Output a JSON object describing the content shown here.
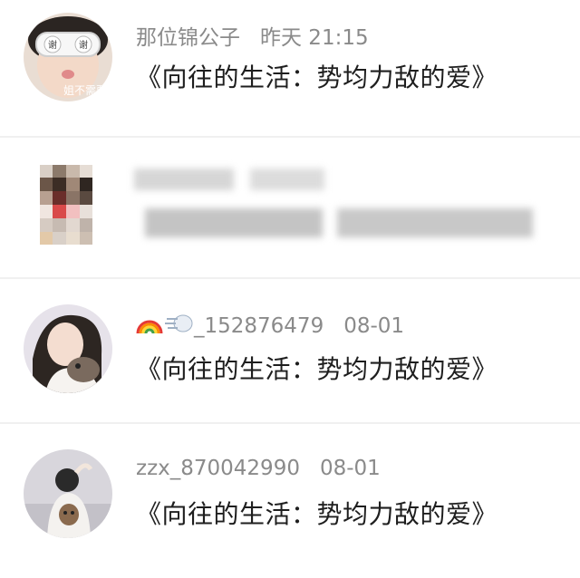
{
  "comments": [
    {
      "user": "那位锦公子",
      "time": "昨天 21:15",
      "text": "《向往的生活：势均力敌的爱》",
      "avatar_overlay_text": "姐不需要"
    },
    {
      "user": "",
      "time": "",
      "text": "",
      "blurred": true
    },
    {
      "user_emoji_1": "🌈",
      "user_emoji_2": "💨",
      "user": "_152876479",
      "time": "08-01",
      "text": "《向往的生活：势均力敌的爱》"
    },
    {
      "user": "zzx_870042990",
      "time": "08-01",
      "text": "《向往的生活：势均力敌的爱》"
    }
  ]
}
